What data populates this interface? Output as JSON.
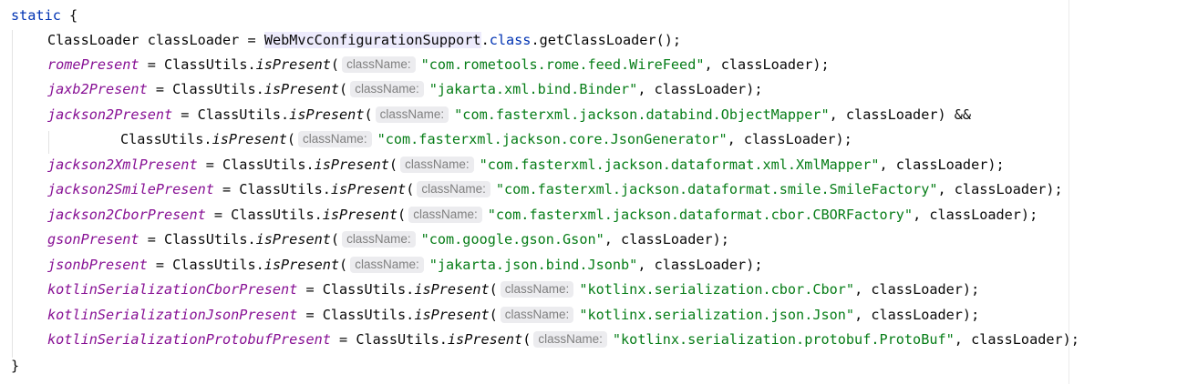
{
  "code": {
    "static_keyword": "static",
    "open_brace": "{",
    "close_brace": "}",
    "line1": {
      "type": "ClassLoader",
      "var": "classLoader",
      "eq": "=",
      "highlighted_class": "WebMvcConfigurationSupport",
      "dot": ".",
      "class_kw": "class",
      "rest": ".getClassLoader();"
    },
    "hint_label": "className:",
    "assignments": [
      {
        "field": "romePresent",
        "pre": " = ClassUtils.",
        "method": "isPresent",
        "open": "(",
        "string": "\"com.rometools.rome.feed.WireFeed\"",
        "post": ", classLoader);"
      },
      {
        "field": "jaxb2Present",
        "pre": " = ClassUtils.",
        "method": "isPresent",
        "open": "(",
        "string": "\"jakarta.xml.bind.Binder\"",
        "post": ", classLoader);"
      },
      {
        "field": "jackson2Present",
        "pre": " = ClassUtils.",
        "method": "isPresent",
        "open": "(",
        "string": "\"com.fasterxml.jackson.databind.ObjectMapper\"",
        "post": ", classLoader) &&"
      },
      {
        "field": "",
        "pre": "ClassUtils.",
        "method": "isPresent",
        "open": "(",
        "string": "\"com.fasterxml.jackson.core.JsonGenerator\"",
        "post": ", classLoader);"
      },
      {
        "field": "jackson2XmlPresent",
        "pre": " = ClassUtils.",
        "method": "isPresent",
        "open": "(",
        "string": "\"com.fasterxml.jackson.dataformat.xml.XmlMapper\"",
        "post": ", classLoader);"
      },
      {
        "field": "jackson2SmilePresent",
        "pre": " = ClassUtils.",
        "method": "isPresent",
        "open": "(",
        "string": "\"com.fasterxml.jackson.dataformat.smile.SmileFactory\"",
        "post": ", classLoader);"
      },
      {
        "field": "jackson2CborPresent",
        "pre": " = ClassUtils.",
        "method": "isPresent",
        "open": "(",
        "string": "\"com.fasterxml.jackson.dataformat.cbor.CBORFactory\"",
        "post": ", classLoader);"
      },
      {
        "field": "gsonPresent",
        "pre": " = ClassUtils.",
        "method": "isPresent",
        "open": "(",
        "string": "\"com.google.gson.Gson\"",
        "post": ", classLoader);"
      },
      {
        "field": "jsonbPresent",
        "pre": " = ClassUtils.",
        "method": "isPresent",
        "open": "(",
        "string": "\"jakarta.json.bind.Jsonb\"",
        "post": ", classLoader);"
      },
      {
        "field": "kotlinSerializationCborPresent",
        "pre": " = ClassUtils.",
        "method": "isPresent",
        "open": "(",
        "string": "\"kotlinx.serialization.cbor.Cbor\"",
        "post": ", classLoader);"
      },
      {
        "field": "kotlinSerializationJsonPresent",
        "pre": " = ClassUtils.",
        "method": "isPresent",
        "open": "(",
        "string": "\"kotlinx.serialization.json.Json\"",
        "post": ", classLoader);"
      },
      {
        "field": "kotlinSerializationProtobufPresent",
        "pre": " = ClassUtils.",
        "method": "isPresent",
        "open": "(",
        "string": "\"kotlinx.serialization.protobuf.ProtoBuf\"",
        "post": ", classLoader);"
      }
    ]
  },
  "colors": {
    "keyword": "#0033b3",
    "field": "#871094",
    "string": "#067d17",
    "hint_text": "#808080",
    "hint_bg": "#ececef",
    "highlight_bg": "#edebfc"
  }
}
